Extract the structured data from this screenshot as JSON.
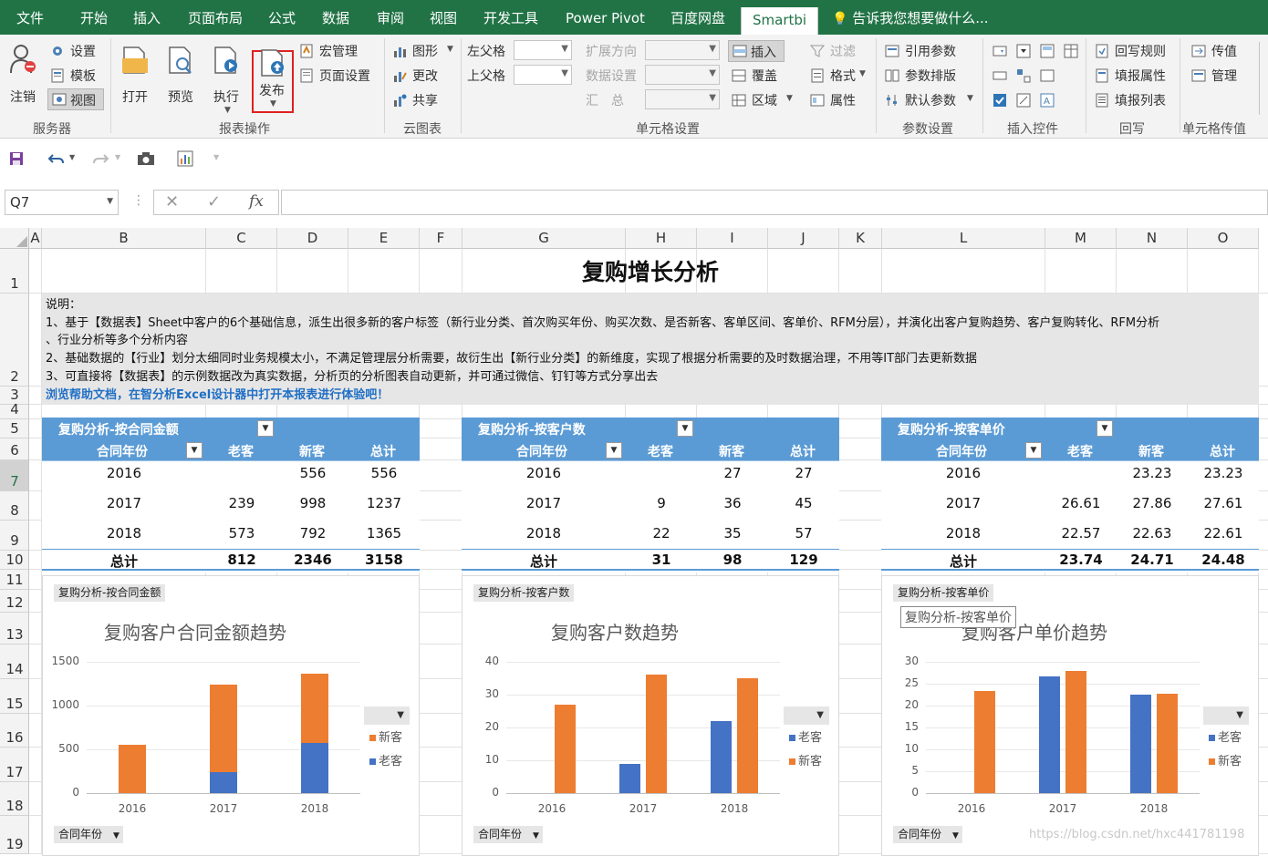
{
  "menu": {
    "tabs": [
      "文件",
      "开始",
      "插入",
      "页面布局",
      "公式",
      "数据",
      "审阅",
      "视图",
      "开发工具",
      "Power Pivot",
      "百度网盘",
      "Smartbi"
    ],
    "active_tab": "Smartbi",
    "tell_me": "告诉我您想要做什么..."
  },
  "ribbon": {
    "server": {
      "login": "注销",
      "settings": "设置",
      "template": "模板",
      "view": "视图",
      "group": "服务器"
    },
    "report": {
      "open": "打开",
      "preview": "预览",
      "execute": "执行",
      "publish": "发布",
      "macro": "宏管理",
      "page_setup": "页面设置",
      "group": "报表操作"
    },
    "cloud": {
      "chart": "图形",
      "update": "更改",
      "share": "共享",
      "group": "云图表"
    },
    "cell_settings": {
      "left_parent": "左父格",
      "upper_parent": "上父格",
      "expand_dir": "扩展方向",
      "data_settings": "数据设置",
      "summary": "汇　总",
      "group": "单元格设置"
    },
    "insert_group": {
      "insert": "插入",
      "cover": "覆盖",
      "region": "区域",
      "filter": "过滤",
      "format": "格式",
      "attr": "属性"
    },
    "params": {
      "ref_params": "引用参数",
      "param_layout": "参数排版",
      "default_params": "默认参数",
      "group": "参数设置"
    },
    "controls": {
      "group": "插入控件"
    },
    "writeback": {
      "rules": "回写规则",
      "fill_attr": "填报属性",
      "fill_list": "填报列表",
      "group": "回写"
    },
    "pass": {
      "pass_value": "传值",
      "manage": "管理",
      "group": "单元格传值"
    }
  },
  "formula_bar": {
    "name_box": "Q7",
    "fx": "fx",
    "value": ""
  },
  "columns": [
    "A",
    "B",
    "C",
    "D",
    "E",
    "F",
    "G",
    "H",
    "I",
    "J",
    "K",
    "L",
    "M",
    "N",
    "O"
  ],
  "rows": [
    "1",
    "2",
    "3",
    "4",
    "5",
    "6",
    "7",
    "8",
    "9",
    "10",
    "11",
    "12",
    "13",
    "14",
    "15",
    "16",
    "17",
    "18",
    "19"
  ],
  "sheet": {
    "title": "复购增长分析",
    "desc_label": "说明：",
    "desc1": "1、基于【数据表】Sheet中客户的6个基础信息，派生出很多新的客户标签（新行业分类、首次购买年份、购买次数、是否新客、客单区间、客单价、RFM分层），并演化出客户复购趋势、客户复购转化、RFM分析",
    "desc1b": "、行业分析等多个分析内容",
    "desc2": "2、基础数据的【行业】划分太细同时业务规模太小，不满足管理层分析需要，故衍生出【新行业分类】的新维度，实现了根据分析需要的及时数据治理，不用等IT部门去更新数据",
    "desc3": "3、可直接将【数据表】的示例数据改为真实数据，分析页的分析图表自动更新，并可通过微信、钉钉等方式分享出去",
    "help_link": "浏览帮助文档，在智分析Excel设计器中打开本报表进行体验吧！"
  },
  "pivots": [
    {
      "title": "复购分析-按合同金额",
      "col_year": "合同年份",
      "col_old": "老客",
      "col_new": "新客",
      "col_total": "总计",
      "rows": [
        [
          "2016",
          "",
          "556",
          "556"
        ],
        [
          "2017",
          "239",
          "998",
          "1237"
        ],
        [
          "2018",
          "573",
          "792",
          "1365"
        ]
      ],
      "total": [
        "总计",
        "812",
        "2346",
        "3158"
      ]
    },
    {
      "title": "复购分析-按客户数",
      "col_year": "合同年份",
      "col_old": "老客",
      "col_new": "新客",
      "col_total": "总计",
      "rows": [
        [
          "2016",
          "",
          "27",
          "27"
        ],
        [
          "2017",
          "9",
          "36",
          "45"
        ],
        [
          "2018",
          "22",
          "35",
          "57"
        ]
      ],
      "total": [
        "总计",
        "31",
        "98",
        "129"
      ]
    },
    {
      "title": "复购分析-按客单价",
      "col_year": "合同年份",
      "col_old": "老客",
      "col_new": "新客",
      "col_total": "总计",
      "rows": [
        [
          "2016",
          "",
          "23.23",
          "23.23"
        ],
        [
          "2017",
          "26.61",
          "27.86",
          "27.61"
        ],
        [
          "2018",
          "22.57",
          "22.63",
          "22.61"
        ]
      ],
      "total": [
        "总计",
        "23.74",
        "24.71",
        "24.48"
      ]
    }
  ],
  "chart_data": [
    {
      "type": "bar",
      "stacked": true,
      "tag": "复购分析-按合同金额",
      "title": "复购客户合同金额趋势",
      "categories": [
        "2016",
        "2017",
        "2018"
      ],
      "series": [
        {
          "name": "新客",
          "values": [
            556,
            998,
            792
          ],
          "color": "#ed7d31"
        },
        {
          "name": "老客",
          "values": [
            0,
            239,
            573
          ],
          "color": "#4472c4"
        }
      ],
      "ylim": [
        0,
        1500
      ],
      "yticks": [
        "1500",
        "1000",
        "500",
        "0"
      ],
      "filter": "合同年份",
      "legend": "right"
    },
    {
      "type": "bar",
      "stacked": false,
      "tag": "复购分析-按客户数",
      "title": "复购客户数趋势",
      "categories": [
        "2016",
        "2017",
        "2018"
      ],
      "series": [
        {
          "name": "老客",
          "values": [
            0,
            9,
            22
          ],
          "color": "#4472c4"
        },
        {
          "name": "新客",
          "values": [
            27,
            36,
            35
          ],
          "color": "#ed7d31"
        }
      ],
      "ylim": [
        0,
        40
      ],
      "yticks": [
        "40",
        "30",
        "20",
        "10",
        "0"
      ],
      "filter": "合同年份",
      "legend": "right"
    },
    {
      "type": "bar",
      "stacked": false,
      "tag": "复购分析-按客单价",
      "title": "复购客户单价趋势",
      "categories": [
        "2016",
        "2017",
        "2018"
      ],
      "series": [
        {
          "name": "老客",
          "values": [
            0,
            26.61,
            22.57
          ],
          "color": "#4472c4"
        },
        {
          "name": "新客",
          "values": [
            23.23,
            27.86,
            22.63
          ],
          "color": "#ed7d31"
        }
      ],
      "ylim": [
        0,
        30
      ],
      "yticks": [
        "30",
        "25",
        "20",
        "15",
        "10",
        "5",
        "0"
      ],
      "filter": "合同年份",
      "legend": "right",
      "tooltip": "复购分析-按客单价"
    }
  ],
  "watermark": "https://blog.csdn.net/hxc441781198"
}
